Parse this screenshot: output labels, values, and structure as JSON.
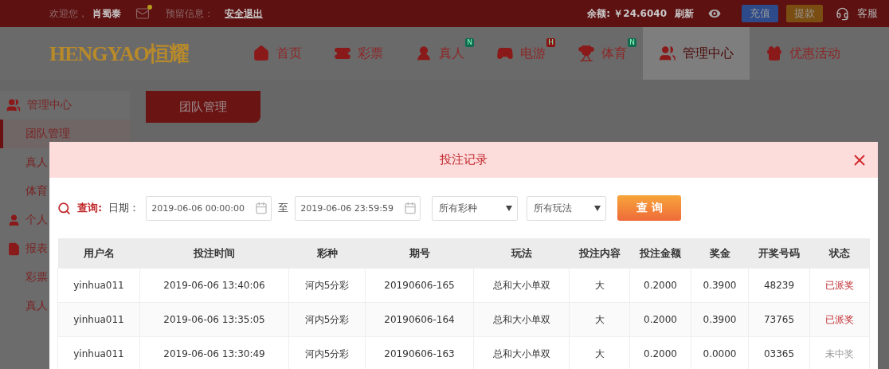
{
  "top_bar": {
    "welcome": "欢迎您，",
    "user": "肖蜀泰",
    "message_label": "预留信息：",
    "logout": "安全退出",
    "balance": "余额: ￥24.6040",
    "refresh": "刷新",
    "deposit": "充值",
    "withdraw": "提款",
    "service": "客服"
  },
  "logo": "HENGYAO恒耀",
  "nav": [
    {
      "label": "首页",
      "selected": false
    },
    {
      "label": "彩票",
      "selected": false
    },
    {
      "label": "真人",
      "selected": false,
      "badge": {
        "text": "N",
        "color": "#0f6b4f"
      }
    },
    {
      "label": "电游",
      "selected": false,
      "badge": {
        "text": "H",
        "color": "#8a1414"
      }
    },
    {
      "label": "体育",
      "selected": false,
      "badge": {
        "text": "N",
        "color": "#0f6b4f"
      }
    },
    {
      "label": "管理中心",
      "selected": true
    },
    {
      "label": "优惠活动",
      "selected": false
    }
  ],
  "sidebar": {
    "title": "管理中心",
    "items": [
      {
        "kind": "sub",
        "label": "团队管理",
        "selected": true
      },
      {
        "kind": "sub",
        "label": "真人",
        "selected": false
      },
      {
        "kind": "sub",
        "label": "体育",
        "selected": false
      },
      {
        "kind": "group",
        "label": "个人",
        "selected": false
      },
      {
        "kind": "group",
        "label": "报表",
        "selected": false
      },
      {
        "kind": "sub",
        "label": "彩票",
        "selected": false
      },
      {
        "kind": "sub",
        "label": "真人",
        "selected": false
      }
    ]
  },
  "content_tab": "团队管理",
  "dialog": {
    "title": "投注记录",
    "filter": {
      "query_label": "查询:",
      "date_label": "日期：",
      "start": "2019-06-06 00:00:00",
      "to": "至",
      "end": "2019-06-06 23:59:59",
      "lottery": "所有彩种",
      "play": "所有玩法",
      "button": "查 询"
    },
    "table": {
      "columns": [
        "用户名",
        "投注时间",
        "彩种",
        "期号",
        "玩法",
        "投注内容",
        "投注金额",
        "奖金",
        "开奖号码",
        "状态"
      ],
      "rows": [
        {
          "cells": [
            "yinhua011",
            "2019-06-06 13:40:06",
            "河内5分彩",
            "20190606-165",
            "总和大小单双",
            "大",
            "0.2000",
            "0.3900",
            "48239",
            "已派奖"
          ],
          "won": true
        },
        {
          "cells": [
            "yinhua011",
            "2019-06-06 13:35:05",
            "河内5分彩",
            "20190606-164",
            "总和大小单双",
            "大",
            "0.2000",
            "0.3900",
            "73765",
            "已派奖"
          ],
          "won": true
        },
        {
          "cells": [
            "yinhua011",
            "2019-06-06 13:30:49",
            "河内5分彩",
            "20190606-163",
            "总和大小单双",
            "大",
            "0.2000",
            "0.0000",
            "03365",
            "未中奖"
          ],
          "won": false
        }
      ]
    }
  }
}
